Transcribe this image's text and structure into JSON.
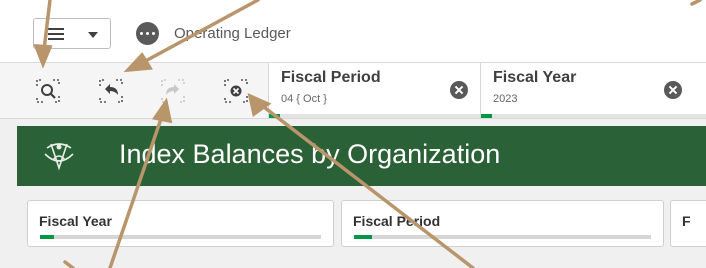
{
  "toolbar": {
    "menu_icon": "hamburger-menu-icon",
    "app_icon": "more-dots-icon",
    "app_title": "Operating Ledger"
  },
  "selection_tools": [
    {
      "name": "smart-search",
      "icon": "search-icon"
    },
    {
      "name": "step-back",
      "icon": "back-arrow-icon"
    },
    {
      "name": "step-forward",
      "icon": "forward-arrow-icon",
      "disabled": true
    },
    {
      "name": "clear-all-selections",
      "icon": "clear-selections-icon"
    }
  ],
  "current_selections": [
    {
      "field": "Fiscal Period",
      "value": "04 { Oct }",
      "selected_fraction": 0.05
    },
    {
      "field": "Fiscal Year",
      "value": "2023",
      "selected_fraction": 0.05
    }
  ],
  "banner": {
    "title": "Index Balances by Organization",
    "crest_icon": "university-crest-icon",
    "color": "#2b6136"
  },
  "filter_panes": [
    {
      "label": "Fiscal Year",
      "selected_fraction": 0.05
    },
    {
      "label": "Fiscal Period",
      "selected_fraction": 0.06
    },
    {
      "label": "F",
      "selected_fraction": 0
    }
  ],
  "annotations": {
    "arrow_color": "#b8956a",
    "arrow_count": 6
  },
  "colors": {
    "selection_green": "#009845",
    "banner_green": "#2b6136"
  }
}
